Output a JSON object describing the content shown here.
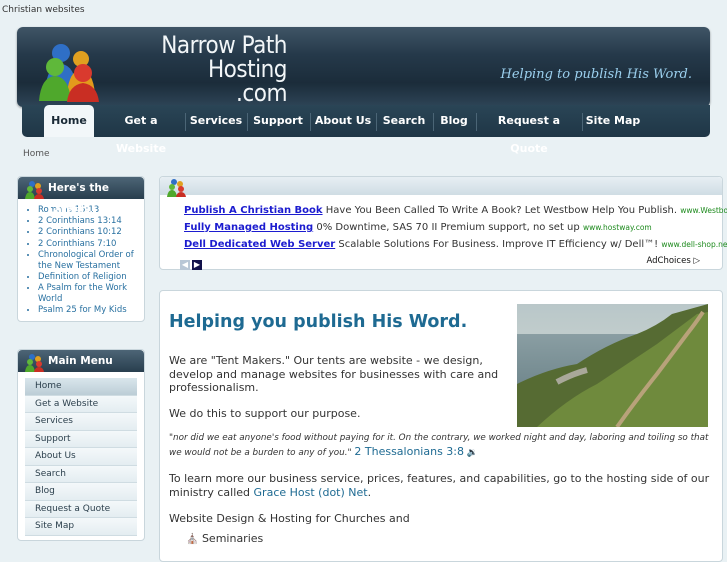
{
  "top_link": "Christian websites",
  "header": {
    "logo_line1": "Narrow Path",
    "logo_line2": "Hosting",
    "logo_line3": ".com",
    "tagline": "Helping to publish His Word."
  },
  "nav": {
    "items": [
      {
        "label": "Home"
      },
      {
        "label": "Get a Website"
      },
      {
        "label": "Services"
      },
      {
        "label": "Support"
      },
      {
        "label": "About Us"
      },
      {
        "label": "Search"
      },
      {
        "label": "Blog"
      },
      {
        "label": "Request a Quote"
      },
      {
        "label": "Site Map"
      }
    ]
  },
  "breadcrumb": "Home",
  "latest": {
    "title": "Here's the Latest...",
    "items": [
      "Romans 15:13",
      "2 Corinthians 13:14",
      "2 Corinthians 10:12",
      "2 Corinthians 7:10",
      "Chronological Order of the New Testament",
      "Definition of Religion",
      "A Psalm for the Work World",
      "Psalm 25 for My Kids"
    ]
  },
  "main_menu": {
    "title": "Main Menu",
    "items": [
      "Home",
      "Get a Website",
      "Services",
      "Support",
      "About Us",
      "Search",
      "Blog",
      "Request a Quote",
      "Site Map"
    ]
  },
  "ads": {
    "items": [
      {
        "title": "Publish A Christian Book",
        "text": "Have You Been Called To Write A Book? Let Westbow Help You Publish.",
        "url": "www.Westbow..."
      },
      {
        "title": "Fully Managed Hosting",
        "text": "0% Downtime, SAS 70 II Premium support, no set up",
        "url": "www.hostway.com"
      },
      {
        "title": "Dell Dedicated Web Server",
        "text": "Scalable Solutions For Business. Improve IT Efficiency w/ Dell™!",
        "url": "www.dell-shop.net"
      }
    ],
    "adchoices": "AdChoices"
  },
  "content": {
    "heading": "Helping you publish His Word.",
    "para1": "We are \"Tent Makers.\"  Our tents are website - we design, develop and manage websites for businesses with care and professionalism.",
    "para2": "We do this to support our purpose.",
    "quote": "\"nor did we eat anyone's food without paying for it. On the contrary, we worked night and day, laboring and toiling so that we would not be a burden to any of you.\"",
    "quote_ref": "2 Thessalonians 3:8",
    "para3_pre": "To learn more our business service, prices, features, and capabilities, go to the hosting side of our ministry called ",
    "para3_link": "Grace Host (dot) Net",
    "para3_post": ".",
    "para4": "Website Design & Hosting for Churches and",
    "list_item": "Seminaries"
  }
}
